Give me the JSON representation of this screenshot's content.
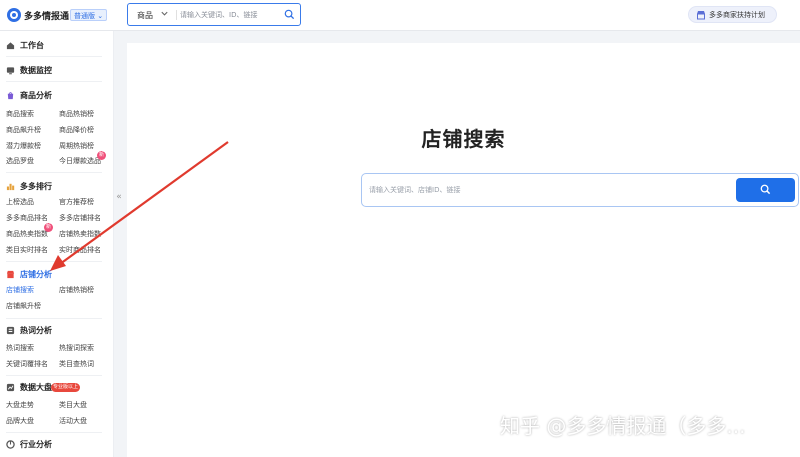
{
  "header": {
    "brand": "多多情报通",
    "edition": "普通版",
    "search": {
      "category": "商品",
      "placeholder": "请输入关键词、ID、链接"
    },
    "plan_label": "多多商家扶持计划"
  },
  "sidebar": {
    "collapse_glyph": "«",
    "workbench": "工作台",
    "monitor": "数据监控",
    "product_analysis": {
      "title": "商品分析",
      "items": [
        "商品搜索",
        "商品热销榜",
        "商品飙升榜",
        "商品降价榜",
        "潜力爆款榜",
        "周期热销榜",
        "选品罗盘",
        "今日爆款选品"
      ]
    },
    "ranking": {
      "title": "多多排行",
      "items": [
        "上榜选品",
        "官方推荐榜",
        "多多商品排名",
        "多多店铺排名",
        "商品热卖指数",
        "店铺热卖指数",
        "类目实时排名",
        "实时商品排名"
      ]
    },
    "shop_analysis": {
      "title": "店铺分析",
      "items": [
        "店铺搜索",
        "店铺热销榜",
        "店铺飙升榜"
      ]
    },
    "hotword": {
      "title": "热词分析",
      "items": [
        "热词搜索",
        "热搜词探索",
        "关键词覆排名",
        "类目查热词"
      ]
    },
    "dashboard": {
      "title": "数据大盘",
      "badge": "专业版以上",
      "items": [
        "大盘走势",
        "类目大盘",
        "品牌大盘",
        "活动大盘"
      ]
    },
    "industry": {
      "title": "行业分析"
    },
    "new_badge": "新"
  },
  "main": {
    "title": "店铺搜索",
    "search_placeholder": "请输入关键词、店铺ID、链接"
  },
  "watermark": "知乎 @多多情报通（多多...",
  "colors": {
    "accent": "#1f6fe8",
    "arrow": "#e03a2e",
    "badge": "#e8483d"
  }
}
